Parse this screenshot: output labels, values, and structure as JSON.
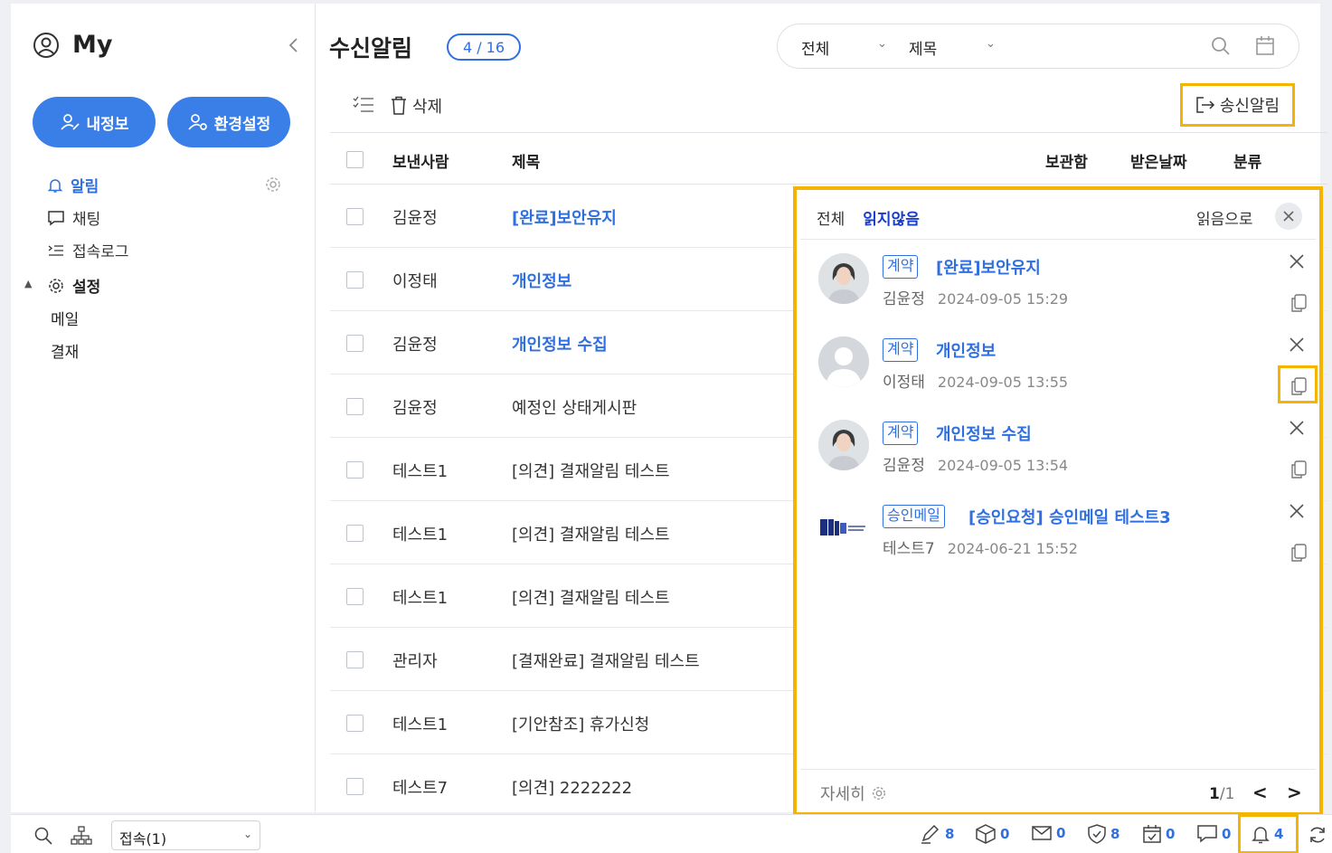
{
  "sidebar": {
    "title": "My",
    "buttons": {
      "profile": "내정보",
      "settings": "환경설정"
    },
    "nav": {
      "alarm": "알림",
      "chat": "채팅",
      "log": "접속로그",
      "settings": "설정",
      "mail": "메일",
      "approval": "결재"
    }
  },
  "main": {
    "title": "수신알림",
    "count": "4 / 16",
    "search": {
      "scope": "전체",
      "field": "제목"
    },
    "toolbar": {
      "delete": "삭제",
      "sent": "송신알림"
    },
    "columns": {
      "sender": "보낸사람",
      "subject": "제목",
      "storage": "보관함",
      "received": "받은날짜",
      "category": "분류"
    },
    "rows": [
      {
        "sender": "김윤정",
        "subject": "[완료]보안유지"
      },
      {
        "sender": "이정태",
        "subject": "개인정보"
      },
      {
        "sender": "김윤정",
        "subject": "개인정보 수집"
      },
      {
        "sender": "김윤정",
        "subject": "예정인 상태게시판"
      },
      {
        "sender": "테스트1",
        "subject": "[의견] 결재알림 테스트"
      },
      {
        "sender": "테스트1",
        "subject": "[의견] 결재알림 테스트"
      },
      {
        "sender": "테스트1",
        "subject": "[의견] 결재알림 테스트"
      },
      {
        "sender": "관리자",
        "subject": "[결재완료] 결재알림 테스트"
      },
      {
        "sender": "테스트1",
        "subject": "[기안참조] 휴가신청"
      },
      {
        "sender": "테스트7",
        "subject": "[의견] 2222222"
      }
    ]
  },
  "notifications": {
    "tabs": {
      "all": "전체",
      "unread": "읽지않음"
    },
    "mark_read": "읽음으로",
    "items": [
      {
        "tag": "계약",
        "title": "[완료]보안유지",
        "sender": "김윤정",
        "date": "2024-09-05 15:29"
      },
      {
        "tag": "계약",
        "title": "개인정보",
        "sender": "이정태",
        "date": "2024-09-05 13:55"
      },
      {
        "tag": "계약",
        "title": "개인정보 수집",
        "sender": "김윤정",
        "date": "2024-09-05 13:54"
      },
      {
        "tag": "승인메일",
        "title": "[승인요청] 승인메일 테스트3",
        "sender": "테스트7",
        "date": "2024-06-21 15:52"
      }
    ],
    "more": "자세히",
    "page": {
      "current": "1",
      "total": "/1"
    },
    "prev": "<",
    "next": ">"
  },
  "statusbar": {
    "status": "접속(1)",
    "counts": {
      "sign": "8",
      "box": "0",
      "mail": "0",
      "shield": "8",
      "calendar": "0",
      "chat": "0",
      "bell": "4"
    }
  },
  "colors": {
    "accent": "#3a7fe8",
    "link": "#2f6fe0",
    "highlight": "#f4b400",
    "unread_tab": "#1a3ec9"
  }
}
